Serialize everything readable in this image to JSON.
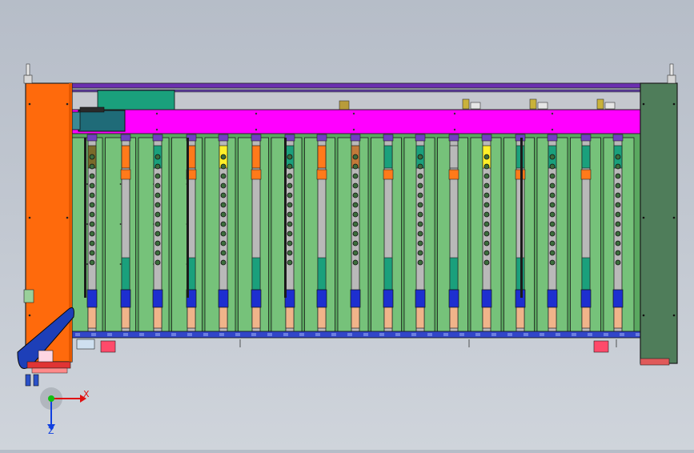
{
  "viewport": {
    "description_free": true,
    "colors": {
      "background_top": "#b6bdc8",
      "background_bottom": "#cfd4db",
      "left_housing": "#ff6a0c",
      "right_housing": "#4f7d5a",
      "main_beam": "#ff00ff",
      "top_rail": "#6b2fb0",
      "panel": "#76c27a",
      "panel_outline": "#1b1b1b",
      "bottom_rail": "#3246c8",
      "motor": "#1f6b78",
      "teal_block": "#1aa07c",
      "blue_segment": "#1d2fd0",
      "peach_segment": "#f0b48a",
      "yellow_accent": "#ffef2a",
      "orange_accent": "#ff7a1a",
      "gray_rod": "#b9b9b9"
    }
  },
  "triad": {
    "x_label": "X",
    "z_label": "Z",
    "icons": [
      "axis-triad-icon"
    ]
  }
}
